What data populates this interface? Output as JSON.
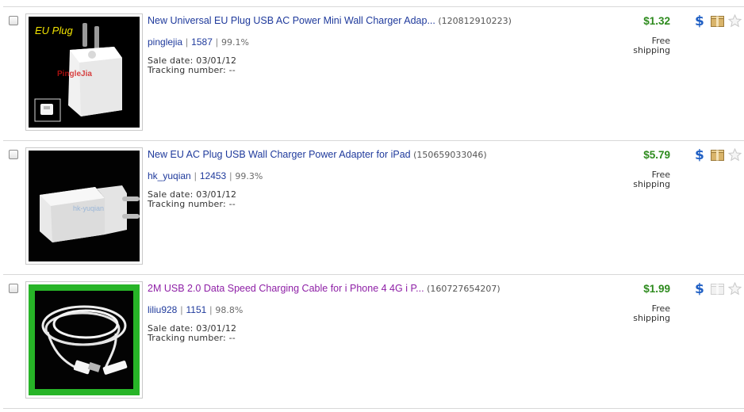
{
  "listings": [
    {
      "title": "New Universal EU Plug USB AC Power Mini Wall Charger Adap...",
      "item_id": "(120812910223)",
      "seller": "pinglejia",
      "feedback_score": "1587",
      "feedback_percent": "99.1%",
      "sale_date": "Sale date: 03/01/12",
      "tracking": "Tracking number: --",
      "price": "$1.32",
      "shipping": [
        "Free",
        "shipping"
      ],
      "image_label": "EU Plug",
      "image_watermark": "PingleJia",
      "visited": false
    },
    {
      "title": "New EU AC Plug USB Wall Charger Power Adapter for iPad",
      "item_id": "(150659033046)",
      "seller": "hk_yuqian",
      "feedback_score": "12453",
      "feedback_percent": "99.3%",
      "sale_date": "Sale date: 03/01/12",
      "tracking": "Tracking number: --",
      "price": "$5.79",
      "shipping": [
        "Free",
        "shipping"
      ],
      "image_watermark": "hk-yuqian",
      "visited": false
    },
    {
      "title": "2M USB 2.0 Data Speed Charging Cable for i Phone 4 4G i P...",
      "item_id": "(160727654207)",
      "seller": "liliu928",
      "feedback_score": "1151",
      "feedback_percent": "98.8%",
      "sale_date": "Sale date: 03/01/12",
      "tracking": "Tracking number: --",
      "price": "$1.99",
      "shipping": [
        "Free",
        "shipping"
      ],
      "visited": true
    }
  ],
  "icons": {
    "paid": "dollar-icon",
    "shipped": "package-icon",
    "feedback": "star-icon"
  },
  "colors": {
    "link": "#1f3a9c",
    "visited_link": "#8e1fa6",
    "price": "#2e8b1e",
    "paid_icon": "#1f5fc4",
    "shipped_icon": "#c9a45a"
  }
}
